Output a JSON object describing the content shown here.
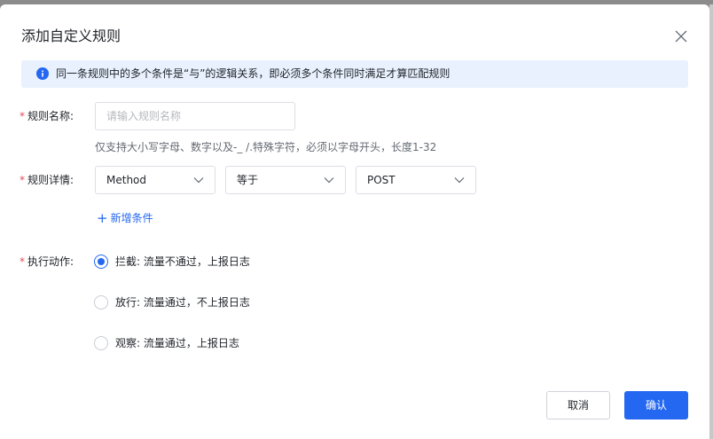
{
  "dialog": {
    "title": "添加自定义规则",
    "notice": "同一条规则中的多个条件是“与”的逻辑关系，即必须多个条件同时满足才算匹配规则"
  },
  "form": {
    "rule_name": {
      "required_mark": "*",
      "label": "规则名称:",
      "placeholder": "请输入规则名称",
      "value": "",
      "hint": "仅支持大小写字母、数字以及-_ /.特殊字符，必须以字母开头，长度1-32"
    },
    "rule_detail": {
      "required_mark": "*",
      "label": "规则详情:",
      "field_select": "Method",
      "operator_select": "等于",
      "value_select": "POST",
      "add_condition": "新增条件"
    },
    "action": {
      "required_mark": "*",
      "label": "执行动作:",
      "options": [
        {
          "label": "拦截: 流量不通过，上报日志",
          "checked": true
        },
        {
          "label": "放行: 流量通过，不上报日志",
          "checked": false
        },
        {
          "label": "观察: 流量通过，上报日志",
          "checked": false
        }
      ]
    }
  },
  "footer": {
    "cancel_label": "取消",
    "ok_label": "确认"
  },
  "colors": {
    "accent": "#2468f2",
    "required": "#e34d59",
    "notice_bg": "#e8f1fd"
  }
}
